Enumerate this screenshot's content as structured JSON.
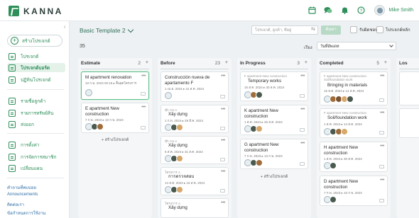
{
  "app": {
    "logo": "KANNA",
    "username": "Mike Smith"
  },
  "sidebar": {
    "new_project": "สร้างโปรเจกต์",
    "items": [
      {
        "label": "โปรเจกต์"
      },
      {
        "label": "โปรเจกต์บอร์ด"
      },
      {
        "label": "ปฏิทินโปรเจกต์"
      },
      {
        "label": "รายชื่อลูกค้า"
      },
      {
        "label": "รายการทรัพย์สิน"
      },
      {
        "label": "ส่งออก"
      },
      {
        "label": "การตั้งค่า"
      },
      {
        "label": "การจัดการสมาชิก"
      },
      {
        "label": "เปลี่ยนแผน"
      }
    ],
    "links": [
      "คำถามที่พบบ่อย",
      "Announcements",
      "ติดต่อเรา",
      "ข้อกำหนดการใช้งาน"
    ]
  },
  "toolbar": {
    "board_title": "Basic Template 2",
    "search_placeholder": "โปรเจกต์, ลูกค้า, ที่อยู่",
    "search_button": "ค้นหา",
    "check1": "รับผิดชอบ",
    "check2": "โปรเจกต์หลัก",
    "count": "35",
    "sort_label": "เรียง",
    "sort_value": "วันที่อัพเดท"
  },
  "columns": [
    {
      "name": "Estimate",
      "count": "2",
      "cards": [
        {
          "title": "M apartment renovation",
          "dates": "10 ก.พ. 2023 00:15 ▸ สิ้นสุดโครงการ"
        },
        {
          "title": "E apartment New construction",
          "dates": "7 ก.พ. 2023 ▸ 10 ก.พ. 2023"
        }
      ],
      "add": "+ สร้างโปรเจกต์"
    },
    {
      "name": "Before",
      "count": "23",
      "cards": [
        {
          "title": "Construcción nueva de apartamento F",
          "dates": "1 เม.ย. 2024 ▸ 31 ส.ค. 2024"
        },
        {
          "sub": "ตุ๊ก Aน A",
          "title": "Xây dựng",
          "dates": "1 ก.พ. 2024 ▸ 29 มี.ค. 2024"
        },
        {
          "sub": "ตุ๊ก Aน A",
          "title": "Xây dựng",
          "dates": "6 ส.ค. 2024 ▸ 31 ส.ค. 2024"
        },
        {
          "sub": "โครงการ A",
          "title": "การตรวจสอบ",
          "dates": "14 ส.ค. 2024 ▸ 16 ส.ค. 2024"
        },
        {
          "sub": "โครงการ A",
          "title": "Xây dựng",
          "dates": ""
        }
      ]
    },
    {
      "name": "In Progress",
      "count": "3",
      "cards": [
        {
          "sub": "F apartment New construction",
          "title": "Temporary works",
          "dates": "15 ส.ค. 2024 ▸ 30 ส.ค. 2024"
        },
        {
          "title": "K apartment New construction",
          "dates": "1 ส.ค. 2024 ▸ 25 ส.ค. 2024"
        },
        {
          "title": "G apartment New construction",
          "dates": "7 ก.พ. 2023 ▸ 13 ก.พ. 2023"
        }
      ],
      "add": "+ สร้างโปรเจกต์"
    },
    {
      "name": "Completed",
      "count": "5",
      "cards": [
        {
          "sub": "F apartment New construction Soil/foundation work",
          "title": "Bringing in materials",
          "dates": "15 ส.ค. 2024 ▸ 14 ส.ค. 2024"
        },
        {
          "sub": "F apartment New construction",
          "title": "Soil/foundation work",
          "dates": "1 ส.ค. 2024 ▸ 14 ส.ค. 2024"
        },
        {
          "title": "H apartment New construction",
          "dates": "1 ส.ค. 2024 ▸ 30 ส.ค. 2024"
        },
        {
          "title": "D apartment New construction",
          "dates": "7 ก.พ. 2023 ▸ 10 ก.พ. 2023"
        }
      ]
    },
    {
      "name": "Los"
    }
  ],
  "colors": {
    "accent": "#2f8f5b",
    "link": "#2f6fa8",
    "board_bg": "#f4f6f7"
  },
  "icons": [
    "calendar-icon",
    "chat-icon",
    "bell-icon",
    "help-icon",
    "plus-icon",
    "more-icon",
    "message-icon"
  ]
}
